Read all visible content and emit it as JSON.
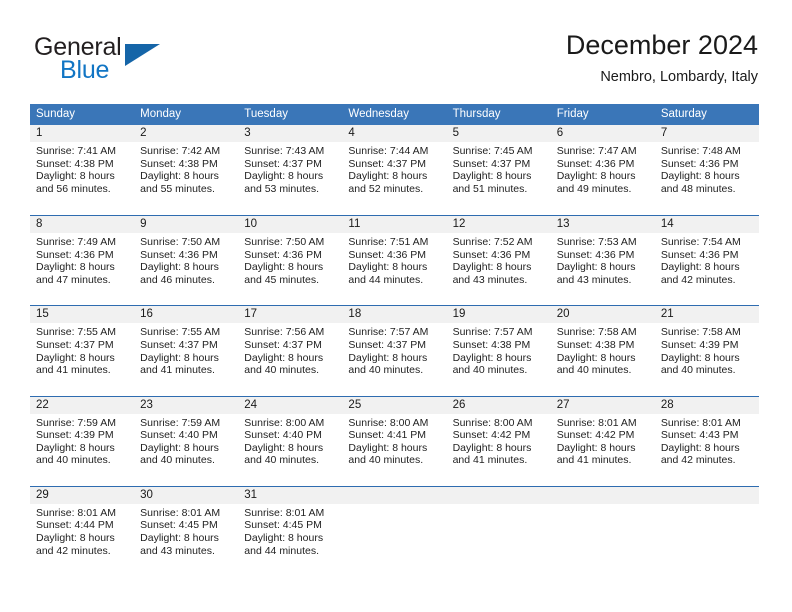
{
  "brand": {
    "name_top": "General",
    "name_bottom": "Blue",
    "triangle_icon": "blue-triangle-icon",
    "color_top": "#231f20",
    "color_bottom": "#1175c4"
  },
  "header": {
    "title": "December 2024",
    "subtitle": "Nembro, Lombardy, Italy"
  },
  "theme": {
    "header_blue": "#3a76b8",
    "row_border_blue": "#2e6cb0",
    "daynum_gray": "#f1f1f1"
  },
  "weekdays": [
    "Sunday",
    "Monday",
    "Tuesday",
    "Wednesday",
    "Thursday",
    "Friday",
    "Saturday"
  ],
  "labels": {
    "sunrise_prefix": "Sunrise:",
    "sunset_prefix": "Sunset:",
    "daylight_prefix": "Daylight:"
  },
  "weeks": [
    [
      {
        "day": "1",
        "sunrise": "Sunrise: 7:41 AM",
        "sunset": "Sunset: 4:38 PM",
        "daylight_line1": "Daylight: 8 hours",
        "daylight_line2": "and 56 minutes."
      },
      {
        "day": "2",
        "sunrise": "Sunrise: 7:42 AM",
        "sunset": "Sunset: 4:38 PM",
        "daylight_line1": "Daylight: 8 hours",
        "daylight_line2": "and 55 minutes."
      },
      {
        "day": "3",
        "sunrise": "Sunrise: 7:43 AM",
        "sunset": "Sunset: 4:37 PM",
        "daylight_line1": "Daylight: 8 hours",
        "daylight_line2": "and 53 minutes."
      },
      {
        "day": "4",
        "sunrise": "Sunrise: 7:44 AM",
        "sunset": "Sunset: 4:37 PM",
        "daylight_line1": "Daylight: 8 hours",
        "daylight_line2": "and 52 minutes."
      },
      {
        "day": "5",
        "sunrise": "Sunrise: 7:45 AM",
        "sunset": "Sunset: 4:37 PM",
        "daylight_line1": "Daylight: 8 hours",
        "daylight_line2": "and 51 minutes."
      },
      {
        "day": "6",
        "sunrise": "Sunrise: 7:47 AM",
        "sunset": "Sunset: 4:36 PM",
        "daylight_line1": "Daylight: 8 hours",
        "daylight_line2": "and 49 minutes."
      },
      {
        "day": "7",
        "sunrise": "Sunrise: 7:48 AM",
        "sunset": "Sunset: 4:36 PM",
        "daylight_line1": "Daylight: 8 hours",
        "daylight_line2": "and 48 minutes."
      }
    ],
    [
      {
        "day": "8",
        "sunrise": "Sunrise: 7:49 AM",
        "sunset": "Sunset: 4:36 PM",
        "daylight_line1": "Daylight: 8 hours",
        "daylight_line2": "and 47 minutes."
      },
      {
        "day": "9",
        "sunrise": "Sunrise: 7:50 AM",
        "sunset": "Sunset: 4:36 PM",
        "daylight_line1": "Daylight: 8 hours",
        "daylight_line2": "and 46 minutes."
      },
      {
        "day": "10",
        "sunrise": "Sunrise: 7:50 AM",
        "sunset": "Sunset: 4:36 PM",
        "daylight_line1": "Daylight: 8 hours",
        "daylight_line2": "and 45 minutes."
      },
      {
        "day": "11",
        "sunrise": "Sunrise: 7:51 AM",
        "sunset": "Sunset: 4:36 PM",
        "daylight_line1": "Daylight: 8 hours",
        "daylight_line2": "and 44 minutes."
      },
      {
        "day": "12",
        "sunrise": "Sunrise: 7:52 AM",
        "sunset": "Sunset: 4:36 PM",
        "daylight_line1": "Daylight: 8 hours",
        "daylight_line2": "and 43 minutes."
      },
      {
        "day": "13",
        "sunrise": "Sunrise: 7:53 AM",
        "sunset": "Sunset: 4:36 PM",
        "daylight_line1": "Daylight: 8 hours",
        "daylight_line2": "and 43 minutes."
      },
      {
        "day": "14",
        "sunrise": "Sunrise: 7:54 AM",
        "sunset": "Sunset: 4:36 PM",
        "daylight_line1": "Daylight: 8 hours",
        "daylight_line2": "and 42 minutes."
      }
    ],
    [
      {
        "day": "15",
        "sunrise": "Sunrise: 7:55 AM",
        "sunset": "Sunset: 4:37 PM",
        "daylight_line1": "Daylight: 8 hours",
        "daylight_line2": "and 41 minutes."
      },
      {
        "day": "16",
        "sunrise": "Sunrise: 7:55 AM",
        "sunset": "Sunset: 4:37 PM",
        "daylight_line1": "Daylight: 8 hours",
        "daylight_line2": "and 41 minutes."
      },
      {
        "day": "17",
        "sunrise": "Sunrise: 7:56 AM",
        "sunset": "Sunset: 4:37 PM",
        "daylight_line1": "Daylight: 8 hours",
        "daylight_line2": "and 40 minutes."
      },
      {
        "day": "18",
        "sunrise": "Sunrise: 7:57 AM",
        "sunset": "Sunset: 4:37 PM",
        "daylight_line1": "Daylight: 8 hours",
        "daylight_line2": "and 40 minutes."
      },
      {
        "day": "19",
        "sunrise": "Sunrise: 7:57 AM",
        "sunset": "Sunset: 4:38 PM",
        "daylight_line1": "Daylight: 8 hours",
        "daylight_line2": "and 40 minutes."
      },
      {
        "day": "20",
        "sunrise": "Sunrise: 7:58 AM",
        "sunset": "Sunset: 4:38 PM",
        "daylight_line1": "Daylight: 8 hours",
        "daylight_line2": "and 40 minutes."
      },
      {
        "day": "21",
        "sunrise": "Sunrise: 7:58 AM",
        "sunset": "Sunset: 4:39 PM",
        "daylight_line1": "Daylight: 8 hours",
        "daylight_line2": "and 40 minutes."
      }
    ],
    [
      {
        "day": "22",
        "sunrise": "Sunrise: 7:59 AM",
        "sunset": "Sunset: 4:39 PM",
        "daylight_line1": "Daylight: 8 hours",
        "daylight_line2": "and 40 minutes."
      },
      {
        "day": "23",
        "sunrise": "Sunrise: 7:59 AM",
        "sunset": "Sunset: 4:40 PM",
        "daylight_line1": "Daylight: 8 hours",
        "daylight_line2": "and 40 minutes."
      },
      {
        "day": "24",
        "sunrise": "Sunrise: 8:00 AM",
        "sunset": "Sunset: 4:40 PM",
        "daylight_line1": "Daylight: 8 hours",
        "daylight_line2": "and 40 minutes."
      },
      {
        "day": "25",
        "sunrise": "Sunrise: 8:00 AM",
        "sunset": "Sunset: 4:41 PM",
        "daylight_line1": "Daylight: 8 hours",
        "daylight_line2": "and 40 minutes."
      },
      {
        "day": "26",
        "sunrise": "Sunrise: 8:00 AM",
        "sunset": "Sunset: 4:42 PM",
        "daylight_line1": "Daylight: 8 hours",
        "daylight_line2": "and 41 minutes."
      },
      {
        "day": "27",
        "sunrise": "Sunrise: 8:01 AM",
        "sunset": "Sunset: 4:42 PM",
        "daylight_line1": "Daylight: 8 hours",
        "daylight_line2": "and 41 minutes."
      },
      {
        "day": "28",
        "sunrise": "Sunrise: 8:01 AM",
        "sunset": "Sunset: 4:43 PM",
        "daylight_line1": "Daylight: 8 hours",
        "daylight_line2": "and 42 minutes."
      }
    ],
    [
      {
        "day": "29",
        "sunrise": "Sunrise: 8:01 AM",
        "sunset": "Sunset: 4:44 PM",
        "daylight_line1": "Daylight: 8 hours",
        "daylight_line2": "and 42 minutes."
      },
      {
        "day": "30",
        "sunrise": "Sunrise: 8:01 AM",
        "sunset": "Sunset: 4:45 PM",
        "daylight_line1": "Daylight: 8 hours",
        "daylight_line2": "and 43 minutes."
      },
      {
        "day": "31",
        "sunrise": "Sunrise: 8:01 AM",
        "sunset": "Sunset: 4:45 PM",
        "daylight_line1": "Daylight: 8 hours",
        "daylight_line2": "and 44 minutes."
      },
      {
        "day": "",
        "sunrise": "",
        "sunset": "",
        "daylight_line1": "",
        "daylight_line2": ""
      },
      {
        "day": "",
        "sunrise": "",
        "sunset": "",
        "daylight_line1": "",
        "daylight_line2": ""
      },
      {
        "day": "",
        "sunrise": "",
        "sunset": "",
        "daylight_line1": "",
        "daylight_line2": ""
      },
      {
        "day": "",
        "sunrise": "",
        "sunset": "",
        "daylight_line1": "",
        "daylight_line2": ""
      }
    ]
  ]
}
